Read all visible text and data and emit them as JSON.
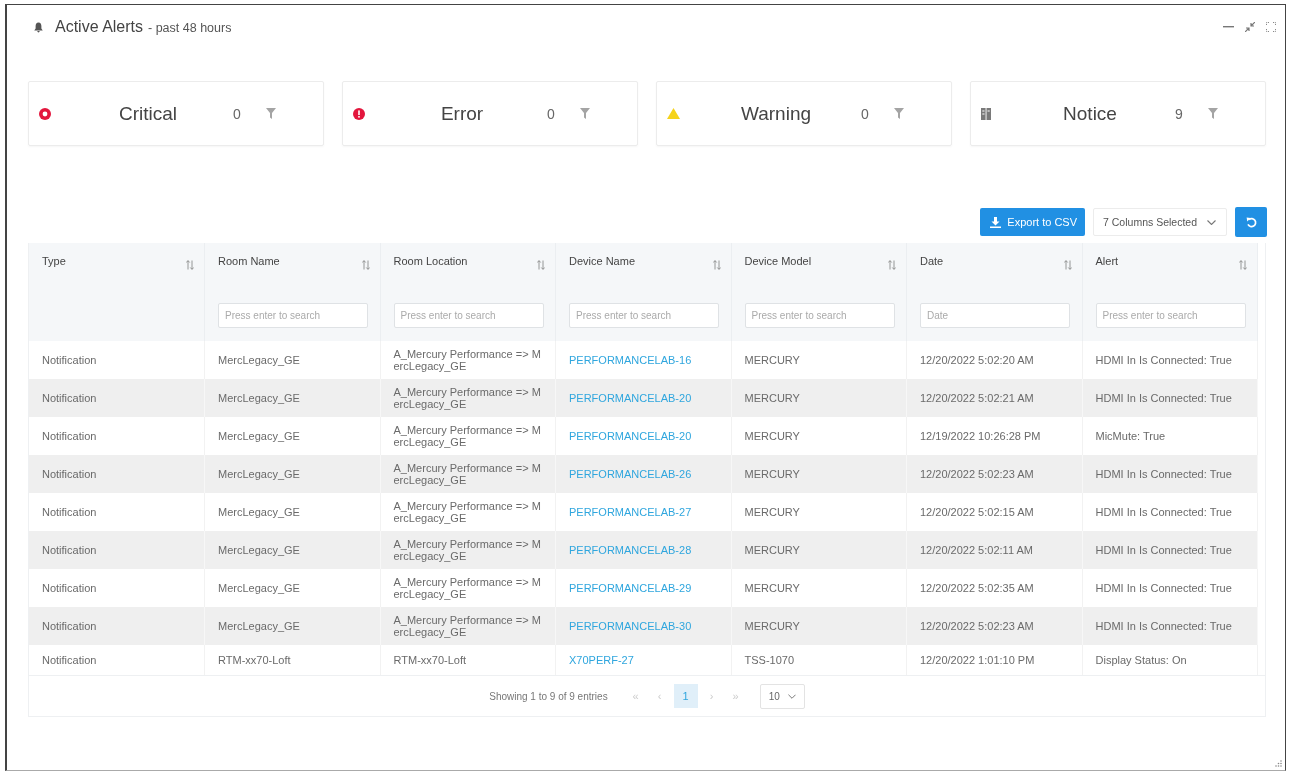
{
  "panel": {
    "title": "Active Alerts",
    "subtitle": "- past 48 hours"
  },
  "summary": [
    {
      "kind": "critical",
      "label": "Critical",
      "count": "0"
    },
    {
      "kind": "error",
      "label": "Error",
      "count": "0"
    },
    {
      "kind": "warning",
      "label": "Warning",
      "count": "0"
    },
    {
      "kind": "notice",
      "label": "Notice",
      "count": "9"
    }
  ],
  "toolbar": {
    "export_button": "Export to CSV",
    "columns_select": "7 Columns Selected"
  },
  "table": {
    "columns": [
      {
        "label": "Type",
        "kind": "text"
      },
      {
        "label": "Room Name",
        "kind": "text",
        "placeholder": "Press enter to search"
      },
      {
        "label": "Room Location",
        "kind": "text",
        "placeholder": "Press enter to search"
      },
      {
        "label": "Device Name",
        "kind": "link",
        "placeholder": "Press enter to search"
      },
      {
        "label": "Device Model",
        "kind": "text",
        "placeholder": "Press enter to search"
      },
      {
        "label": "Date",
        "kind": "text",
        "placeholder": "Date"
      },
      {
        "label": "Alert",
        "kind": "text",
        "placeholder": "Press enter to search"
      }
    ],
    "rows": [
      [
        "Notification",
        "MercLegacy_GE",
        "A_Mercury Performance => MercLegacy_GE",
        "PERFORMANCELAB-16",
        "MERCURY",
        "12/20/2022 5:02:20 AM",
        "HDMI In Is Connected: True"
      ],
      [
        "Notification",
        "MercLegacy_GE",
        "A_Mercury Performance => MercLegacy_GE",
        "PERFORMANCELAB-20",
        "MERCURY",
        "12/20/2022 5:02:21 AM",
        "HDMI In Is Connected: True"
      ],
      [
        "Notification",
        "MercLegacy_GE",
        "A_Mercury Performance => MercLegacy_GE",
        "PERFORMANCELAB-20",
        "MERCURY",
        "12/19/2022 10:26:28 PM",
        "MicMute: True"
      ],
      [
        "Notification",
        "MercLegacy_GE",
        "A_Mercury Performance => MercLegacy_GE",
        "PERFORMANCELAB-26",
        "MERCURY",
        "12/20/2022 5:02:23 AM",
        "HDMI In Is Connected: True"
      ],
      [
        "Notification",
        "MercLegacy_GE",
        "A_Mercury Performance => MercLegacy_GE",
        "PERFORMANCELAB-27",
        "MERCURY",
        "12/20/2022 5:02:15 AM",
        "HDMI In Is Connected: True"
      ],
      [
        "Notification",
        "MercLegacy_GE",
        "A_Mercury Performance => MercLegacy_GE",
        "PERFORMANCELAB-28",
        "MERCURY",
        "12/20/2022 5:02:11 AM",
        "HDMI In Is Connected: True"
      ],
      [
        "Notification",
        "MercLegacy_GE",
        "A_Mercury Performance => MercLegacy_GE",
        "PERFORMANCELAB-29",
        "MERCURY",
        "12/20/2022 5:02:35 AM",
        "HDMI In Is Connected: True"
      ],
      [
        "Notification",
        "MercLegacy_GE",
        "A_Mercury Performance => MercLegacy_GE",
        "PERFORMANCELAB-30",
        "MERCURY",
        "12/20/2022 5:02:23 AM",
        "HDMI In Is Connected: True"
      ],
      [
        "Notification",
        "RTM-xx70-Loft",
        "RTM-xx70-Loft",
        "X70PERF-27",
        "TSS-1070",
        "12/20/2022 1:01:10 PM",
        "Display Status: On"
      ]
    ]
  },
  "pagination": {
    "info": "Showing 1 to 9 of 9 entries",
    "nav_before": [
      {
        "label": "«",
        "disabled": true
      },
      {
        "label": "‹",
        "disabled": true
      }
    ],
    "pages": [
      {
        "label": "1",
        "selected": true
      }
    ],
    "nav_after": [
      {
        "label": "›",
        "disabled": true
      },
      {
        "label": "»",
        "disabled": true
      }
    ],
    "page_size": "10"
  }
}
